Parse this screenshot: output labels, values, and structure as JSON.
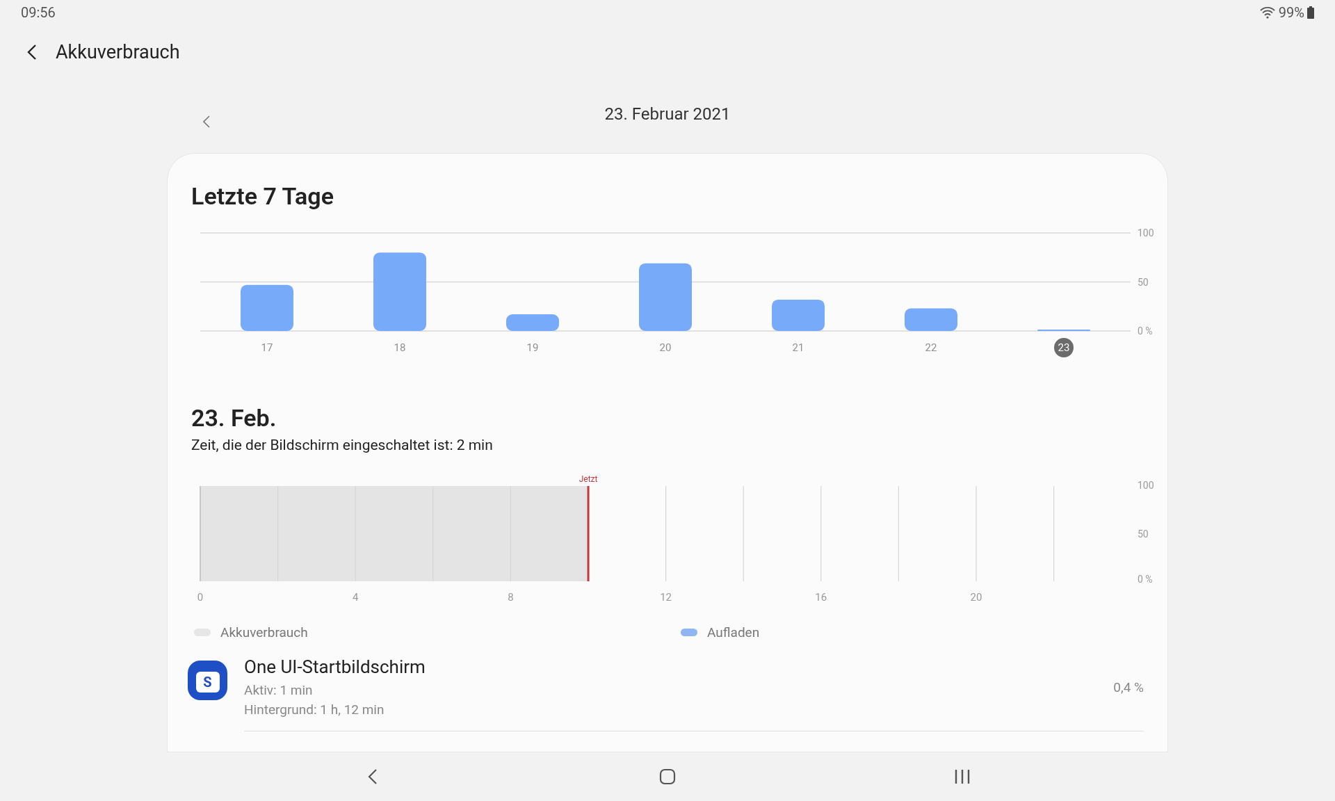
{
  "status_bar": {
    "time": "09:56",
    "battery": "99%"
  },
  "header": {
    "title": "Akkuverbrauch"
  },
  "date_nav": {
    "date": "23. Februar 2021"
  },
  "weekly": {
    "title": "Letzte 7 Tage",
    "selected_category": "23",
    "chart_data": {
      "type": "bar",
      "categories": [
        "17",
        "18",
        "19",
        "20",
        "21",
        "22",
        "23"
      ],
      "series": [
        {
          "color": "#78aafa",
          "values": [
            47,
            80,
            17,
            69,
            32,
            23,
            1
          ]
        }
      ],
      "ylim": [
        0,
        100
      ],
      "yticks": [
        {
          "value": 0,
          "label": "0 %"
        },
        {
          "value": 50,
          "label": "50"
        },
        {
          "value": 100,
          "label": "100"
        }
      ]
    }
  },
  "day": {
    "title": "23. Feb.",
    "screen_time": "Zeit, die der Bildschirm eingeschaltet ist: 2 min",
    "timeline": {
      "now_label": "Jetzt",
      "level": 0.4167,
      "xticks": [
        "0",
        "4",
        "8",
        "12",
        "16",
        "20"
      ],
      "yticks": [
        "100",
        "50",
        "0 %"
      ]
    }
  },
  "legend": [
    {
      "label": "Akkuverbrauch",
      "color": "#e6e6e6"
    },
    {
      "label": "Aufladen",
      "color": "#8fb5f5"
    }
  ],
  "apps": [
    {
      "name": "One UI-Startbildschirm",
      "icon_letter": "S",
      "active": "Aktiv: 1 min",
      "background": "Hintergrund: 1 h, 12 min",
      "percent": "0,4 %"
    }
  ]
}
